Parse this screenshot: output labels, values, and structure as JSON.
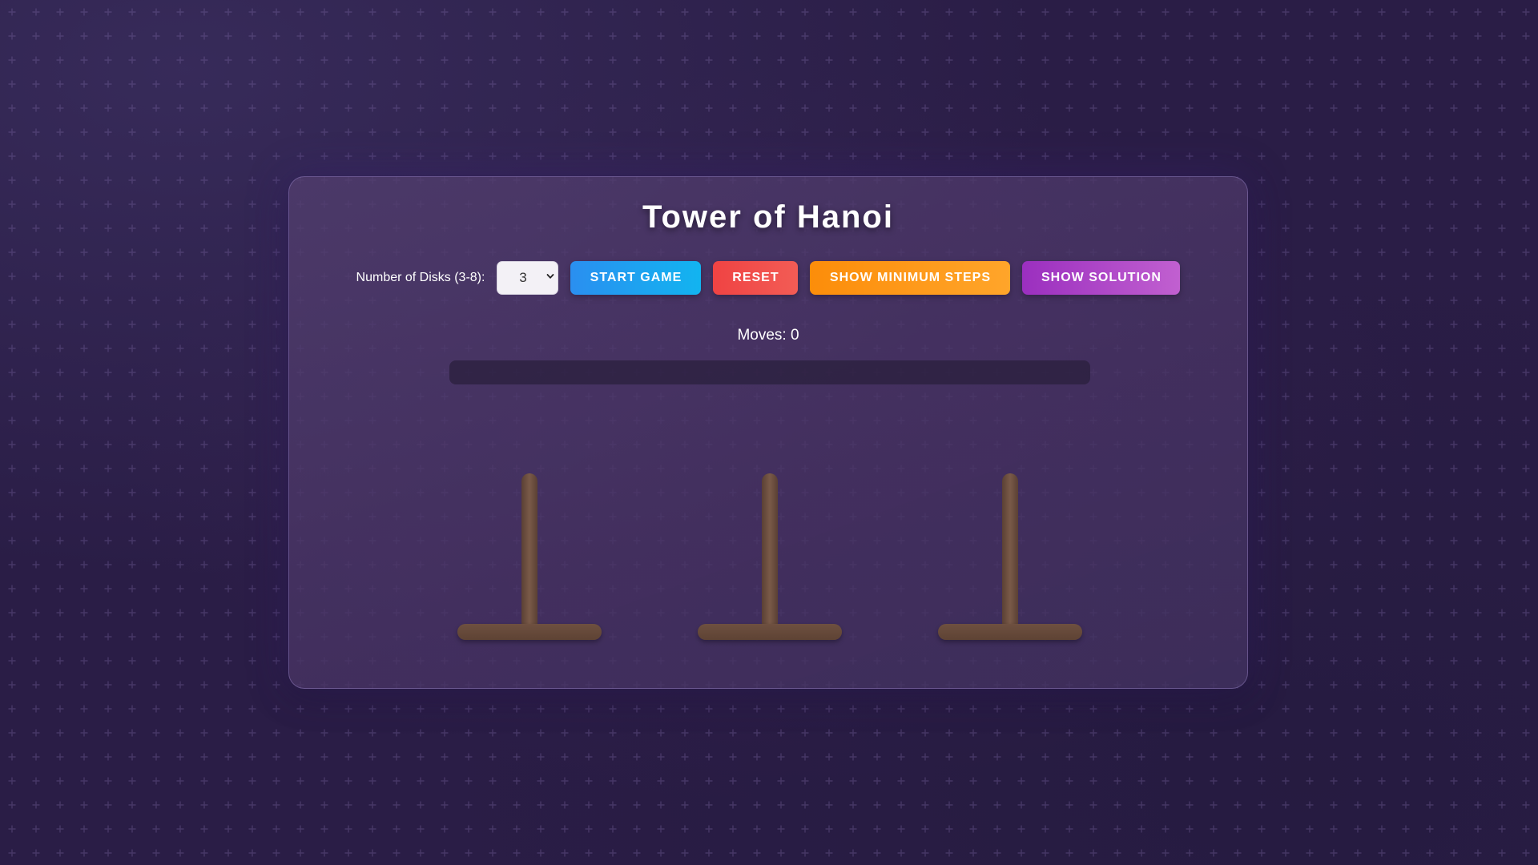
{
  "game": {
    "title": "Tower of Hanoi",
    "moves_label": "Moves: 0",
    "moves": 0,
    "progress_fraction": 0,
    "towers": [
      {
        "name": "tower-a",
        "disks": []
      },
      {
        "name": "tower-b",
        "disks": []
      },
      {
        "name": "tower-c",
        "disks": []
      }
    ]
  },
  "controls": {
    "disk_label": "Number of Disks (3-8):",
    "disk_value": "3",
    "start_label": "START GAME",
    "reset_label": "RESET",
    "steps_label": "SHOW MINIMUM STEPS",
    "solution_label": "SHOW SOLUTION"
  },
  "colors": {
    "background": "#2a1d46",
    "start": "#1ea5f0",
    "reset": "#f04e4b",
    "steps": "#fd981a",
    "solution": "#ad46c7",
    "peg": "#6b4c3d"
  },
  "icons": {
    "select_arrow": "chevron-down-icon"
  }
}
